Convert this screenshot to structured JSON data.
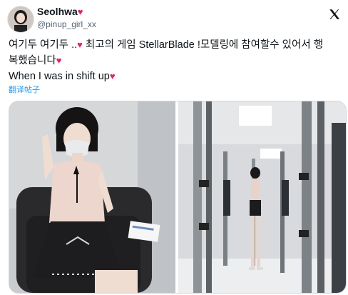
{
  "author": {
    "display_name": "Seolhwa",
    "name_emoji": "♥",
    "handle": "@pinup_girl_xx"
  },
  "tweet": {
    "line1_text": "여기두 여기두 ..",
    "line1_emoji": "♥",
    "line1_text2": " 최고의 게임 StellarBlade !모델링에 참여할수 있어서 행",
    "line2_text": "복했습니다",
    "line2_emoji": "♥",
    "line3_text": "When I was in shift up",
    "line3_emoji": "♥",
    "translate_label": "翻译帖子"
  },
  "icons": {
    "more": "x-logo-icon",
    "heart": "red-heart-icon"
  },
  "colors": {
    "text": "#0f1419",
    "secondary": "#536471",
    "link": "#1d9bf0",
    "heart": "#e0245e",
    "border": "#cfd9de"
  }
}
